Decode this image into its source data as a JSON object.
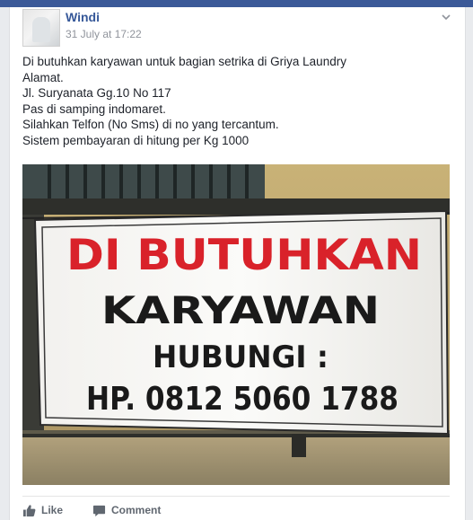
{
  "post": {
    "author": "Windi",
    "timestamp": "31 July at 17:22",
    "text_lines": [
      "Di butuhkan karyawan untuk bagian setrika di Griya Laundry",
      "Alamat.",
      "Jl. Suryanata Gg.10 No 117",
      "Pas di samping indomaret.",
      "Silahkan Telfon (No Sms) di no yang tercantum.",
      "Sistem pembayaran di hitung per Kg 1000"
    ]
  },
  "banner": {
    "line1": "DI BUTUHKAN",
    "line2": "KARYAWAN",
    "line3": "HUBUNGI :",
    "line4": "HP. 0812 5060 1788"
  },
  "actions": {
    "like_label": "Like",
    "comment_label": "Comment"
  },
  "colors": {
    "brand_blue": "#3b5998",
    "name_link": "#365899",
    "banner_red": "#d9222a",
    "banner_black": "#1a1a1a"
  }
}
